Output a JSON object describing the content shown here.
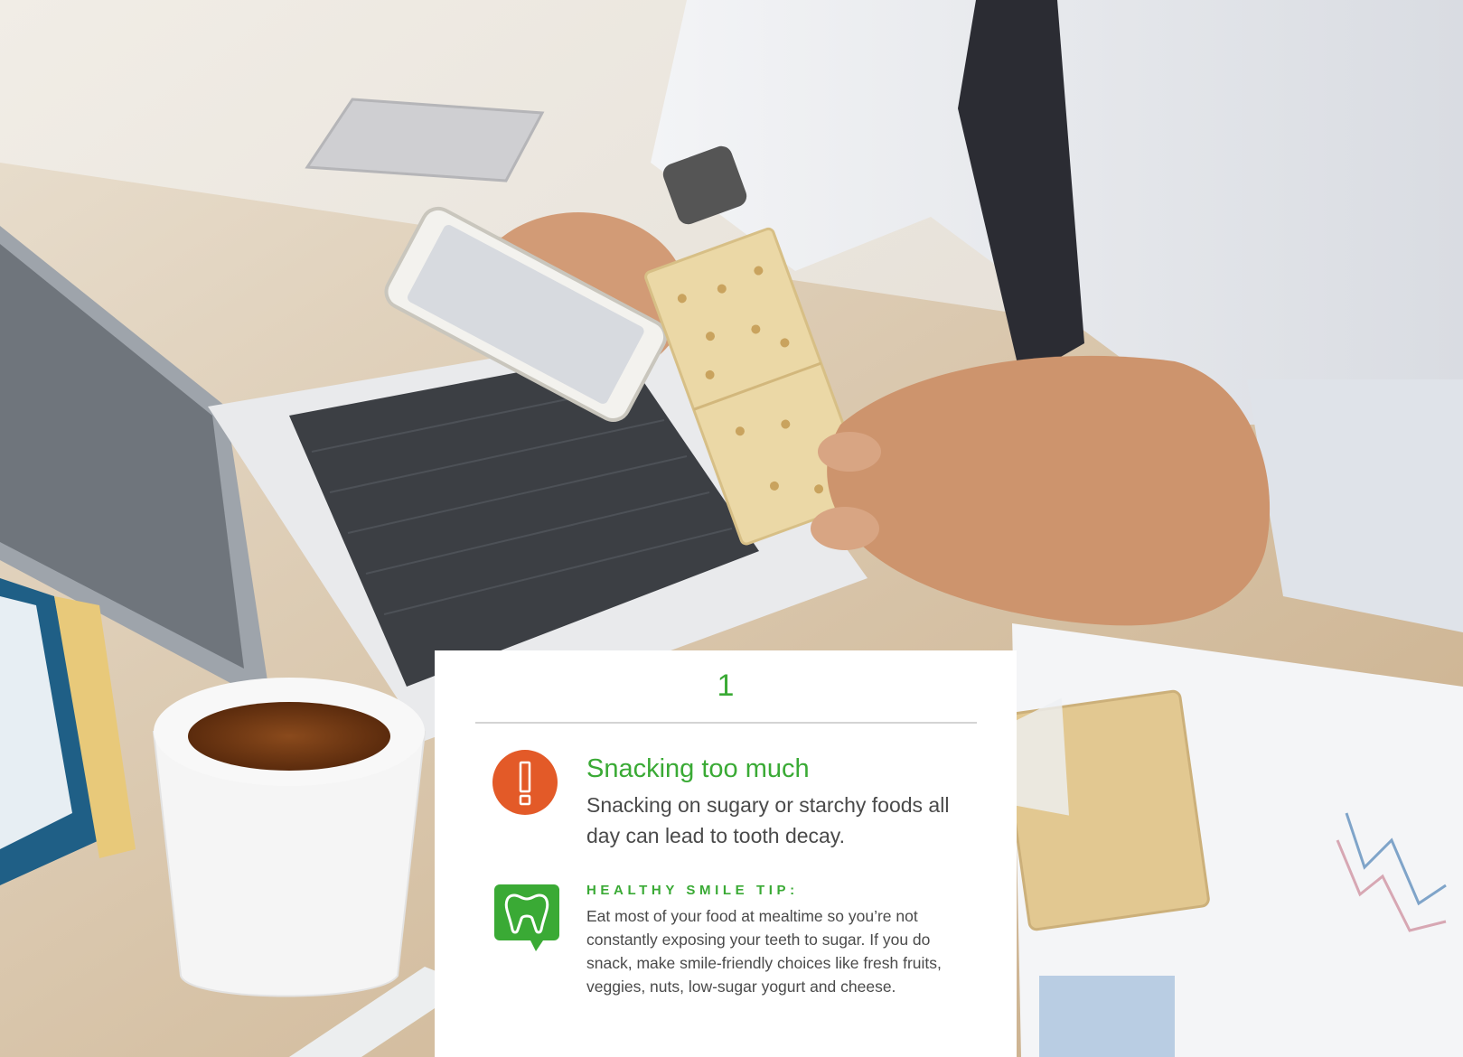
{
  "photo": {
    "icon": "office-desk-snack-photo",
    "colors": {
      "desk": "#d9c7ab",
      "shirt": "#e9ebef",
      "tie": "#2b2c33",
      "skin": "#d29b76",
      "cracker": "#ebd8a6",
      "tea": "#7b3f18"
    }
  },
  "card": {
    "number": "1",
    "heading": "Snacking too much",
    "body": "Snacking on sugary or starchy foods all day can lead to tooth decay.",
    "tip_label": "HEALTHY SMILE TIP:",
    "tip_text": "Eat most of your food at mealtime so you’re not constantly exposing your teeth to sugar. If you do snack, make smile-friendly choices like fresh fruits, veggies, nuts, low-sugar yogurt and cheese.",
    "alert_icon": "exclamation-icon",
    "tip_icon": "tooth-icon",
    "colors": {
      "accent": "#3aaa35",
      "alert": "#e35a28",
      "text": "#4a4a4a",
      "rule": "#d4d4d4"
    }
  }
}
